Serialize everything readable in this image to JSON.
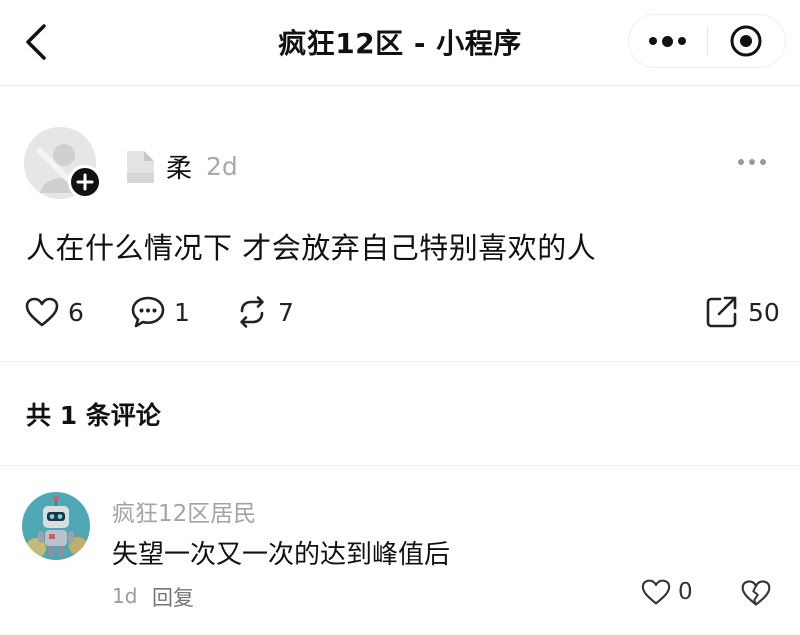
{
  "navbar": {
    "title": "疯狂12区 - 小程序"
  },
  "post": {
    "username": "柔",
    "time": "2d",
    "content": "人在什么情况下 才会放弃自己特别喜欢的人",
    "likes": "6",
    "comments": "1",
    "reposts": "7",
    "shares": "50"
  },
  "comments_section": {
    "total_label": "共 1 条评论",
    "items": [
      {
        "author": "疯狂12区居民",
        "text": "失望一次又一次的达到峰值后",
        "time": "1d",
        "reply_label": "回复",
        "likes": "0"
      }
    ]
  },
  "icons": [
    "back-icon",
    "more-dots-icon",
    "close-target-icon",
    "follow-plus-icon",
    "heart-icon",
    "comment-icon",
    "repost-icon",
    "share-icon",
    "broken-heart-icon"
  ]
}
